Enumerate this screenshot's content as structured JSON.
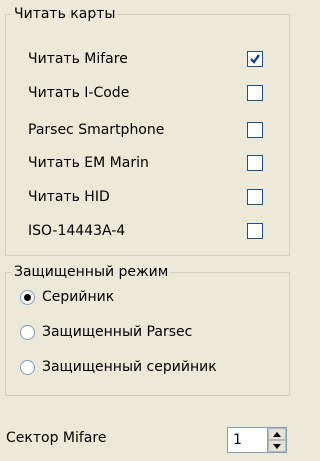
{
  "read_cards": {
    "title": "Читать карты",
    "items": [
      {
        "label": "Читать Mifare",
        "checked": true
      },
      {
        "label": "Читать I-Code",
        "checked": false
      },
      {
        "label": "Parsec Smartphone",
        "checked": false
      },
      {
        "label": "Читать EM Marin",
        "checked": false
      },
      {
        "label": "Читать HID",
        "checked": false
      },
      {
        "label": "ISO-14443A-4",
        "checked": false
      }
    ]
  },
  "protected_mode": {
    "title": "Защищенный режим",
    "options": [
      {
        "label": "Серийник",
        "selected": true
      },
      {
        "label": "Защищенный Parsec",
        "selected": false
      },
      {
        "label": "Защищенный серийник",
        "selected": false
      }
    ]
  },
  "sector": {
    "label": "Сектор Mifare",
    "value": "1"
  }
}
